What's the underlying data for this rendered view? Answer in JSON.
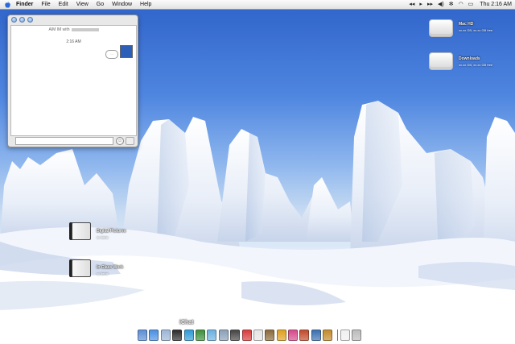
{
  "menubar": {
    "apple_icon": "apple-icon",
    "items": [
      {
        "label": "Finder",
        "bold": true
      },
      {
        "label": "File"
      },
      {
        "label": "Edit"
      },
      {
        "label": "View"
      },
      {
        "label": "Go"
      },
      {
        "label": "Window"
      },
      {
        "label": "Help"
      }
    ],
    "status_icons": [
      "rewind-icon",
      "play-pause-icon",
      "fast-forward-icon",
      "volume-icon",
      "bluetooth-icon",
      "airport-icon",
      "battery-icon"
    ],
    "clock": "Thu 2:16 AM"
  },
  "chat_window": {
    "title": "AIM IM with",
    "time": "2:16 AM",
    "bubble_text": "..."
  },
  "desktop_icons": [
    {
      "name": "Mac HD",
      "sub": "xx.xx GB, xx.xx GB free"
    },
    {
      "name": "Downloads",
      "sub": "xx.xx GB, xx.xx GB free"
    },
    {
      "name": "Digital Pictures",
      "sub": "xx items"
    },
    {
      "name": "In Class Work",
      "sub": "xx items"
    }
  ],
  "dock": {
    "tooltip": "iChat",
    "items": [
      {
        "icon": "finder-icon",
        "color": "#5b8fd6"
      },
      {
        "icon": "safari-icon",
        "color": "#4a90e2"
      },
      {
        "icon": "mail-icon",
        "color": "#9cb6d6"
      },
      {
        "icon": "ichat-icon",
        "color": "#2a2a2a"
      },
      {
        "icon": "messenger-icon",
        "color": "#2f9bd6"
      },
      {
        "icon": "address-book-icon",
        "color": "#3c8f3c"
      },
      {
        "icon": "itunes-icon",
        "color": "#6bb0e0"
      },
      {
        "icon": "iphoto-icon",
        "color": "#8aa0b8"
      },
      {
        "icon": "imovie-icon",
        "color": "#444444"
      },
      {
        "icon": "ical-icon",
        "color": "#d83b3b"
      },
      {
        "icon": "preview-icon",
        "color": "#e5e5e5"
      },
      {
        "icon": "pencil-icon",
        "color": "#8b6a3a"
      },
      {
        "icon": "checkmark-icon",
        "color": "#e0a020"
      },
      {
        "icon": "flower-icon",
        "color": "#d64a8a"
      },
      {
        "icon": "cube-icon",
        "color": "#c24a2a"
      },
      {
        "icon": "books-icon",
        "color": "#3a6fb0"
      },
      {
        "icon": "shell-icon",
        "color": "#c28a2a"
      }
    ],
    "after_separator": [
      {
        "icon": "documents-icon",
        "color": "#f0f0f0"
      },
      {
        "icon": "trash-icon",
        "color": "#bcbcbc"
      }
    ]
  }
}
